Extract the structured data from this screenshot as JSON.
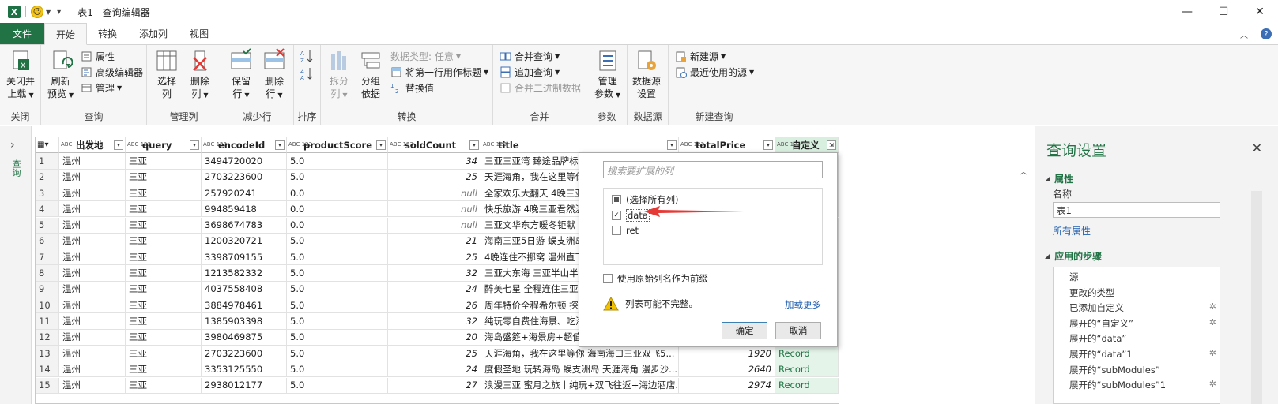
{
  "title_bar": {
    "app_logo": "X",
    "title": "表1 - 查询编辑器"
  },
  "window_buttons": {
    "minimize": "—",
    "maximize": "☐",
    "close": "✕"
  },
  "tabs": [
    {
      "label": "文件"
    },
    {
      "label": "开始"
    },
    {
      "label": "转换"
    },
    {
      "label": "添加列"
    },
    {
      "label": "视图"
    }
  ],
  "ribbon": {
    "close": {
      "btn1": "关闭并",
      "btn2": "上载",
      "group": "关闭"
    },
    "query": {
      "refresh1": "刷新",
      "refresh2": "预览",
      "properties": "属性",
      "advanced_editor": "高级编辑器",
      "manage": "管理",
      "group": "查询"
    },
    "manage_columns": {
      "choose1": "选择",
      "choose2": "列",
      "remove1": "删除",
      "remove2": "列",
      "group": "管理列"
    },
    "reduce_rows": {
      "keep1": "保留",
      "keep2": "行",
      "remove1": "删除",
      "remove2": "行",
      "group": "减少行"
    },
    "sort": {
      "group": "排序"
    },
    "transform": {
      "split1": "拆分",
      "split2": "列",
      "group1": "分组",
      "group2": "依据",
      "data_type": "数据类型: 任意",
      "first_row": "将第一行用作标题",
      "replace": "替换值",
      "group": "转换"
    },
    "combine": {
      "merge": "合并查询",
      "append": "追加查询",
      "combine_binaries": "合并二进制数据",
      "group": "合并"
    },
    "params": {
      "manage1": "管理",
      "manage2": "参数",
      "group": "参数"
    },
    "datasource": {
      "settings1": "数据源",
      "settings2": "设置",
      "group": "数据源"
    },
    "new_query": {
      "new_source": "新建源",
      "recent": "最近使用的源",
      "group": "新建查询"
    }
  },
  "left_pane": {
    "label": "查询"
  },
  "grid": {
    "columns": [
      {
        "type": "ABC",
        "name": "出发地"
      },
      {
        "type": "ABC 123",
        "name": "query"
      },
      {
        "type": "ABC 123",
        "name": "encodeId"
      },
      {
        "type": "ABC 123",
        "name": "productScore"
      },
      {
        "type": "ABC 123",
        "name": "soldCount"
      },
      {
        "type": "ABC 123",
        "name": "title"
      },
      {
        "type": "ABC 123",
        "name": "totalPrice"
      },
      {
        "type": "ABC 123",
        "name": "自定义"
      }
    ],
    "rows": [
      [
        "1",
        "温州",
        "三亚",
        "3494720020",
        "5.0",
        "34",
        "三亚三亚湾 臻途品牌标",
        "",
        ""
      ],
      [
        "2",
        "温州",
        "三亚",
        "2703223600",
        "5.0",
        "25",
        "天涯海角，我在这里等你",
        "",
        ""
      ],
      [
        "3",
        "温州",
        "三亚",
        "257920241",
        "0.0",
        "null",
        "全家欢乐大翻天 4晚三亚",
        "",
        ""
      ],
      [
        "4",
        "温州",
        "三亚",
        "994859418",
        "0.0",
        "null",
        "快乐旅游 4晚三亚君然温",
        "",
        ""
      ],
      [
        "5",
        "温州",
        "三亚",
        "3698674783",
        "0.0",
        "null",
        "三亚文华东方暖冬钜献 3",
        "",
        ""
      ],
      [
        "6",
        "温州",
        "三亚",
        "1200320721",
        "5.0",
        "21",
        "海南三亚5日游 蜈支洲岛",
        "",
        ""
      ],
      [
        "7",
        "温州",
        "三亚",
        "3398709155",
        "5.0",
        "25",
        "4晚连住不挪窝 温州直飞",
        "",
        ""
      ],
      [
        "8",
        "温州",
        "三亚",
        "1213582332",
        "5.0",
        "32",
        "三亚大东海 三亚半山半岛",
        "",
        ""
      ],
      [
        "9",
        "温州",
        "三亚",
        "4037558408",
        "5.0",
        "24",
        "醉美七星 全程连住三亚",
        "",
        ""
      ],
      [
        "10",
        "温州",
        "三亚",
        "3884978461",
        "5.0",
        "26",
        "周年特价全程希尔顿 探秘",
        "",
        ""
      ],
      [
        "11",
        "温州",
        "三亚",
        "1385903398",
        "5.0",
        "32",
        "纯玩零自费住海景、吃海",
        "",
        ""
      ],
      [
        "12",
        "温州",
        "三亚",
        "3980469875",
        "5.0",
        "20",
        "海岛盛筵+海景房+超值购",
        "",
        ""
      ],
      [
        "13",
        "温州",
        "三亚",
        "2703223600",
        "5.0",
        "25",
        "天涯海角，我在这里等你 海南海口三亚双飞5...",
        "1920",
        "Record"
      ],
      [
        "14",
        "温州",
        "三亚",
        "3353125550",
        "5.0",
        "24",
        "度假圣地 玩转海岛 蜈支洲岛 天涯海角 漫步沙...",
        "2640",
        "Record"
      ],
      [
        "15",
        "温州",
        "三亚",
        "2938012177",
        "5.0",
        "27",
        "浪漫三亚 蜜月之旅丨纯玩+双飞往返+海边酒店...",
        "2974",
        "Record"
      ]
    ]
  },
  "popup": {
    "search_placeholder": "搜索要扩展的列",
    "items": [
      {
        "label": "(选择所有列)",
        "state": "partial"
      },
      {
        "label": "data",
        "state": "checked"
      },
      {
        "label": "ret",
        "state": "unchecked"
      }
    ],
    "use_prefix": "使用原始列名作为前缀",
    "warning": "列表可能不完整。",
    "load_more": "加载更多",
    "ok": "确定",
    "cancel": "取消"
  },
  "right_pane": {
    "title": "查询设置",
    "properties_header": "属性",
    "name_label": "名称",
    "name_value": "表1",
    "all_properties": "所有属性",
    "steps_header": "应用的步骤",
    "steps": [
      {
        "label": "源",
        "gear": false
      },
      {
        "label": "更改的类型",
        "gear": false
      },
      {
        "label": "已添加自定义",
        "gear": true
      },
      {
        "label": "展开的“自定义”",
        "gear": true
      },
      {
        "label": "展开的“data”",
        "gear": false
      },
      {
        "label": "展开的“data”1",
        "gear": true
      },
      {
        "label": "展开的“subModules”",
        "gear": false
      },
      {
        "label": "展开的“subModules”1",
        "gear": true
      }
    ]
  },
  "colors": {
    "accent": "#217346",
    "link": "#1f5fb0",
    "arrow": "#e53935"
  }
}
